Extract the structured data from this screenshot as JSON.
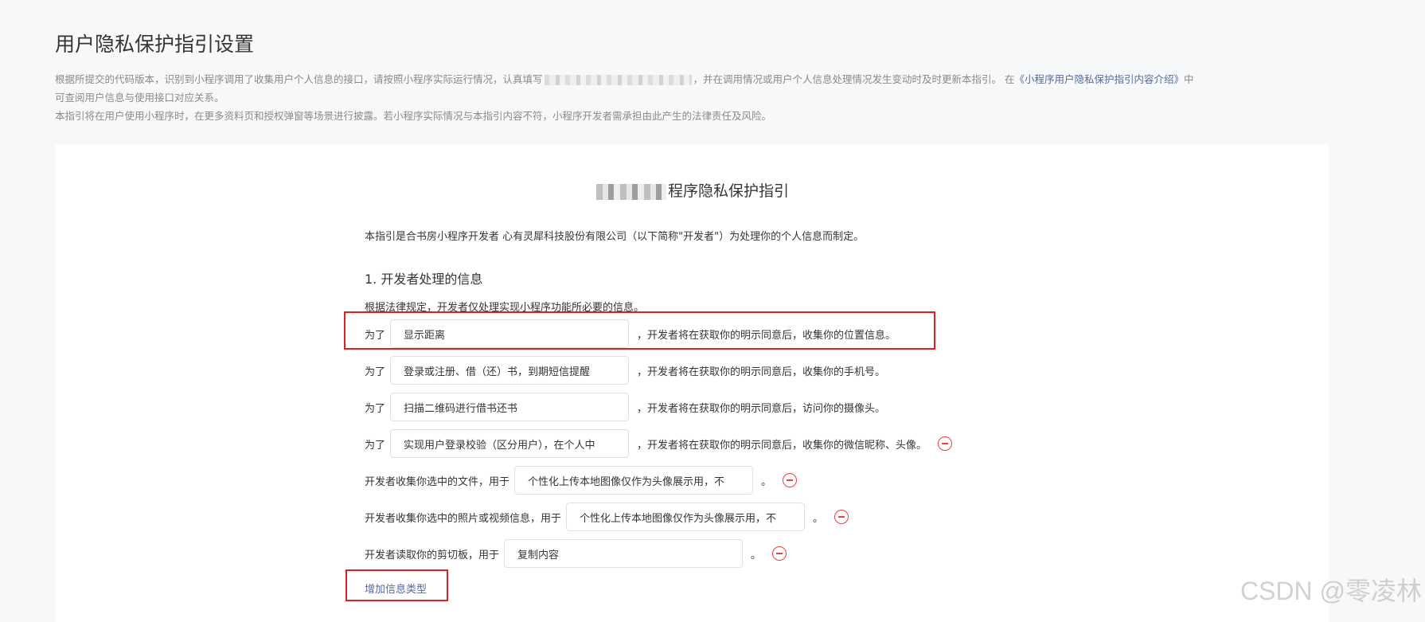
{
  "header": {
    "title": "用户隐私保护指引设置",
    "desc_part1": "根据所提交的代码版本，识别到小程序调用了收集用户个人信息的接口，请按照小程序实际运行情况，认真填写",
    "desc_part2": "，并在调用情况或用户个人信息处理情况发生变动时及时更新本指引。 在",
    "desc_link": "《小程序用户隐私保护指引内容介绍》",
    "desc_part3": "中",
    "desc_line2": "可查阅用户信息与使用接口对应关系。",
    "desc_line3": "本指引将在用户使用小程序时，在更多资料页和授权弹窗等场景进行披露。若小程序实际情况与本指引内容不符，小程序开发者需承担由此产生的法律责任及风险。"
  },
  "doc": {
    "title_suffix": "程序隐私保护指引",
    "intro": "本指引是合书房小程序开发者 心有灵犀科技股份有限公司（以下简称\"开发者\"）为处理你的个人信息而制定。",
    "section1_title": "1. 开发者处理的信息",
    "law_text": "根据法律规定，开发者仅处理实现小程序功能所必要的信息。",
    "rows": [
      {
        "prefix": "为了",
        "value": "显示距离",
        "suffix": "，开发者将在获取你的明示同意后，收集你的位置信息。"
      },
      {
        "prefix": "为了",
        "value": "登录或注册、借（还）书，到期短信提醒",
        "suffix": "，开发者将在获取你的明示同意后，收集你的手机号。"
      },
      {
        "prefix": "为了",
        "value": "扫描二维码进行借书还书",
        "suffix": "，开发者将在获取你的明示同意后，访问你的摄像头。"
      },
      {
        "prefix": "为了",
        "value": "实现用户登录校验（区分用户），在个人中",
        "suffix": "，开发者将在获取你的明示同意后，收集你的微信昵称、头像。"
      },
      {
        "prefix": "开发者收集你选中的文件，用于",
        "value": "个性化上传本地图像仅作为头像展示用，不",
        "suffix": "。"
      },
      {
        "prefix": "开发者收集你选中的照片或视频信息，用于",
        "value": "个性化上传本地图像仅作为头像展示用，不",
        "suffix": "。"
      },
      {
        "prefix": "开发者读取你的剪切板，用于",
        "value": "复制内容",
        "suffix": "。"
      }
    ],
    "add_label": "增加信息类型"
  },
  "watermark": "CSDN @零凌林",
  "colors": {
    "link": "#576b95",
    "danger": "#e64340",
    "highlight": "#e02020",
    "background": "#f7f8fa"
  }
}
